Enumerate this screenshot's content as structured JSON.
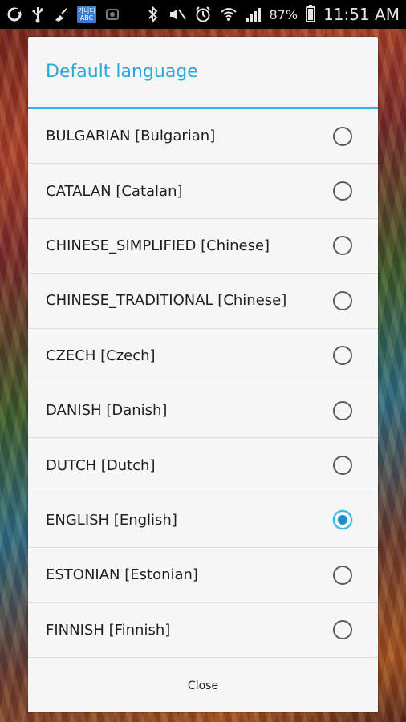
{
  "status_bar": {
    "battery_percent": "87%",
    "time": "11:51 AM",
    "battery_level": 0.87,
    "abc_badge_top": "가나다",
    "abc_badge_bottom": "ABC",
    "icons": [
      "notification-app-icon",
      "usb-icon",
      "cleanup-icon",
      "keyboard-abc-icon",
      "screen-icon",
      "bluetooth-icon",
      "mute-icon",
      "alarm-icon",
      "wifi-icon",
      "signal-icon",
      "battery-icon"
    ]
  },
  "dialog": {
    "title": "Default language",
    "items": [
      {
        "label": "BULGARIAN [Bulgarian]",
        "selected": false
      },
      {
        "label": "CATALAN [Catalan]",
        "selected": false
      },
      {
        "label": "CHINESE_SIMPLIFIED [Chinese]",
        "selected": false
      },
      {
        "label": "CHINESE_TRADITIONAL [Chinese]",
        "selected": false
      },
      {
        "label": "CZECH [Czech]",
        "selected": false
      },
      {
        "label": "DANISH [Danish]",
        "selected": false
      },
      {
        "label": "DUTCH [Dutch]",
        "selected": false
      },
      {
        "label": "ENGLISH [English]",
        "selected": true
      },
      {
        "label": "ESTONIAN [Estonian]",
        "selected": false
      },
      {
        "label": "FINNISH [Finnish]",
        "selected": false
      }
    ],
    "close_label": "Close"
  },
  "colors": {
    "accent": "#33b5e5",
    "title": "#2ba8d8",
    "dialog_bg": "#f6f6f6"
  }
}
